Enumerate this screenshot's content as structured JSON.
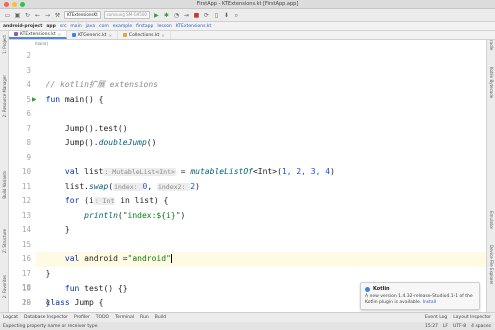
{
  "window": {
    "title": "FirstApp - KTExtensions.kt [FirstApp.app]"
  },
  "toolbar": {
    "config": "KTExtensionsKt",
    "device": "samsung SM-G9500"
  },
  "breadcrumb": [
    "android-project",
    "app",
    "src",
    "main",
    "java",
    "com",
    "example",
    "firstapp",
    "lesson",
    "KTExtensions.kt"
  ],
  "tabs": [
    {
      "label": "KTExtensions.kt",
      "color": "#9b59b6",
      "active": true
    },
    {
      "label": "KTGeneric.kt",
      "color": "#3d82e6",
      "active": false
    },
    {
      "label": "Collections.kt",
      "color": "#e6a23c",
      "active": false
    }
  ],
  "sub_breadcrumb": "main()",
  "left_panels": [
    "1: Project",
    "2: Resource Manager",
    "Z: Structure",
    "2: Favorites",
    "Build Variants"
  ],
  "right_panels": [
    "Gradle",
    "Kotlin Bytecode",
    "Emulator",
    "Device File Explorer"
  ],
  "code": {
    "line_numbers": [
      "2",
      "3",
      "4",
      "5",
      "6",
      "7",
      "8",
      "9",
      "10",
      "11",
      "12",
      "13",
      "14",
      "15",
      "16",
      "17",
      "18",
      "19",
      "20"
    ],
    "line2": "",
    "line3_comment": "// kotlin扩展 extensions",
    "line4_kw": "fun",
    "line4_rest": " main() {",
    "line6": "Jump().test()",
    "line7_a": "Jump().",
    "line7_b": "doubleJump",
    "line7_c": "()",
    "line9_kw": "val",
    "line9_a": " list",
    "line9_hint": ": MutableList<Int>",
    "line9_b": " = ",
    "line9_fn": "mutableListOf",
    "line9_c": "<Int>(",
    "line9_nums": "1, 2, 3, 4",
    "line9_d": ")",
    "line10_a": "list.",
    "line10_fn": "swap",
    "line10_b": "(",
    "line10_hint1": "index: ",
    "line10_n1": "0",
    "line10_c": ",",
    "line10_hint2": "index2: ",
    "line10_n2": "2",
    "line10_d": ")",
    "line11_kw": "for",
    "line11_a": " (i",
    "line11_hint": ": Int",
    "line11_b": " in list) {",
    "line12_fn": "println",
    "line12_a": "(",
    "line12_str": "\"index:${i}\"",
    "line12_b": ")",
    "line13": "}",
    "line15_kw": "val",
    "line15_a": " android =",
    "line15_str": "\"android\"",
    "line16": "}",
    "line18_kw": "class",
    "line18_a": " Jump {",
    "line19_kw": "fun",
    "line19_a": " test() {}",
    "line20": "}"
  },
  "notification": {
    "title": "Kotlin",
    "body": "A new version 1.4.32-release-Studio4.1-1 of the Kotlin plugin is available.",
    "link": "Install"
  },
  "bottom_tools": [
    "Logcat",
    "Database Inspector",
    "Profiler",
    "TODO",
    "Terminal",
    "Run",
    "Build"
  ],
  "bottom_right_tools": [
    "Event Log",
    "Layout Inspector"
  ],
  "status": {
    "message": "Expecting property name or receiver type",
    "position": "15:27",
    "line_sep": "LF",
    "encoding": "UTF-8",
    "indent": "4 spaces"
  },
  "colors": {
    "accent": "#4a88f0",
    "keyword": "#0033b3",
    "string": "#067d17",
    "number": "#1750eb",
    "current_line": "#fffae3"
  }
}
